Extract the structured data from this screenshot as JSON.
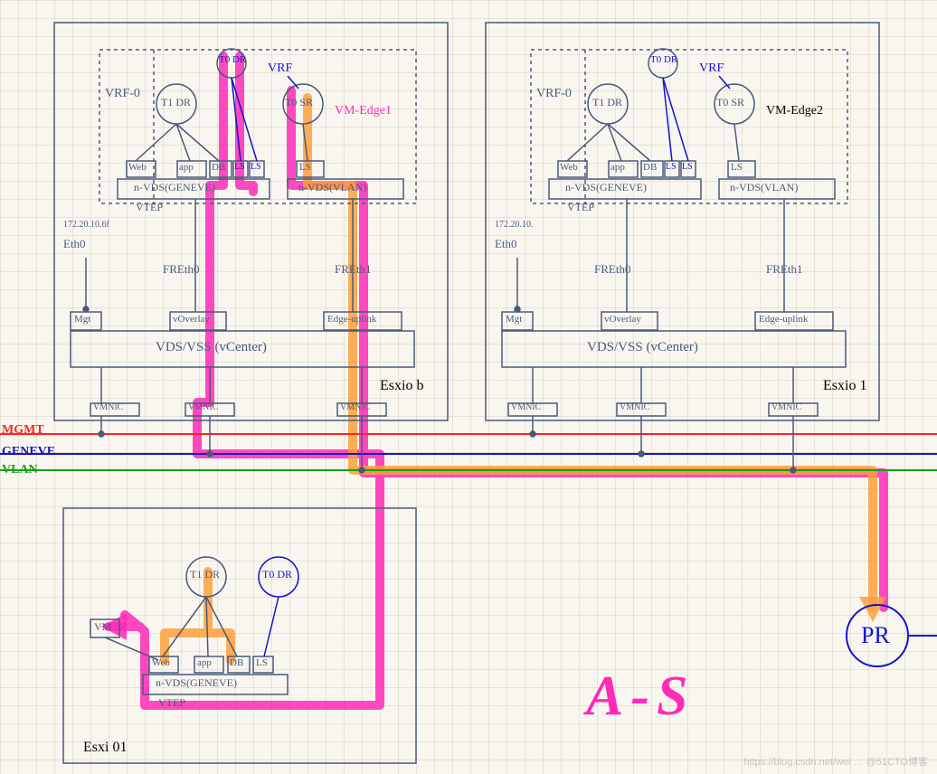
{
  "legend": {
    "mgmt": "MGMT",
    "geneve": "GENEVE",
    "vlan": "VLAN"
  },
  "as_label": "A-S",
  "pr_label": "PR",
  "watermark": "https://blog.csdn.net/wei … @51CTO博客",
  "host1": {
    "name": "Esxio b",
    "vrf0": "VRF-0",
    "vrf": "VRF",
    "t1dr": "T1 DR",
    "t0dr": "T0 DR",
    "t0sr": "T0 SR",
    "vmedge": "VM-Edge1",
    "web": "Web",
    "app": "app",
    "db": "DB",
    "ls1": "LS",
    "ls2": "LS",
    "ls3": "LS",
    "nvds_geneve": "n-VDS(GENEVE)",
    "nvds_vlan": "n-VDS(VLAN)",
    "vtep": "VTEP",
    "ethip": "172.20.10.6f",
    "eth0": "Eth0",
    "freth0": "FREth0",
    "freth1": "FREth1",
    "mgt": "Mgt",
    "overlay": "vOverlay",
    "edgeup": "Edge-uplink",
    "vdsvss": "VDS/VSS (vCenter)",
    "vmnic": "VMNIC"
  },
  "host2": {
    "name": "Esxio 1",
    "vrf0": "VRF-0",
    "vrf": "VRF",
    "t1dr": "T1 DR",
    "t0dr": "T0 DR",
    "t0sr": "T0 SR",
    "vmedge": "VM-Edge2",
    "web": "Web",
    "app": "app",
    "db": "DB",
    "ls1": "LS",
    "ls2": "LS",
    "ls3": "LS",
    "nvds_geneve": "n-VDS(GENEVE)",
    "nvds_vlan": "n-VDS(VLAN)",
    "vtep": "VTEP",
    "ethip": "172.20.10.",
    "eth0": "Eth0",
    "freth0": "FREth0",
    "freth1": "FREth1",
    "mgt": "Mgt",
    "overlay": "vOverlay",
    "edgeup": "Edge-uplink",
    "vdsvss": "VDS/VSS (vCenter)",
    "vmnic": "VMNIC"
  },
  "host3": {
    "name": "Esxi 01",
    "t1dr": "T1 DR",
    "t0dr": "T0 DR",
    "vm": "VM",
    "web": "Web",
    "app": "app",
    "db": "DB",
    "ls": "LS",
    "nvds_geneve": "n-VDS(GENEVE)",
    "vtep": "VTEP"
  },
  "colors": {
    "mgmt": "#ff2222",
    "geneve": "#1414c8",
    "vlan": "#14a014",
    "highlight1": "#ff2ab8",
    "highlight2": "#ffa03c",
    "ink": "#4a5a7a"
  }
}
